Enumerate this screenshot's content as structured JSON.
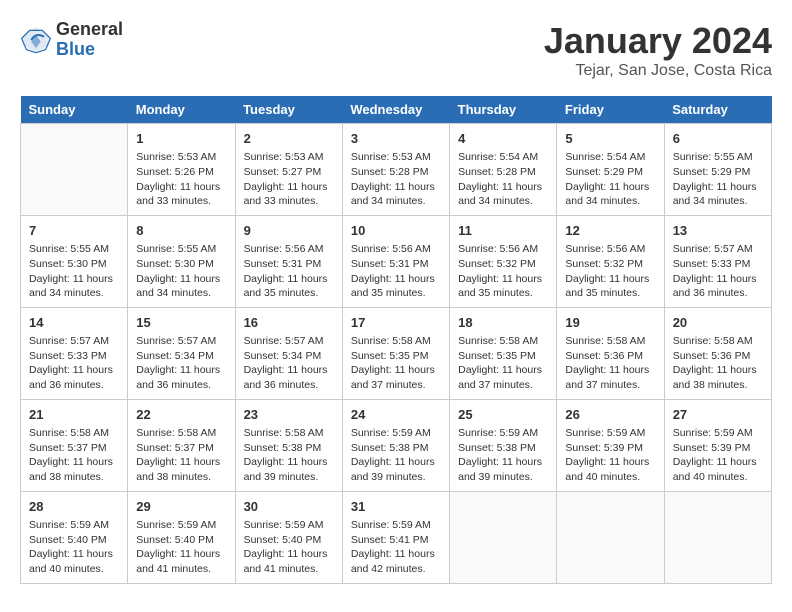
{
  "header": {
    "logo_line1": "General",
    "logo_line2": "Blue",
    "title": "January 2024",
    "subtitle": "Tejar, San Jose, Costa Rica"
  },
  "weekdays": [
    "Sunday",
    "Monday",
    "Tuesday",
    "Wednesday",
    "Thursday",
    "Friday",
    "Saturday"
  ],
  "weeks": [
    [
      {
        "day": "",
        "empty": true
      },
      {
        "day": "1",
        "sunrise": "5:53 AM",
        "sunset": "5:26 PM",
        "daylight": "11 hours and 33 minutes."
      },
      {
        "day": "2",
        "sunrise": "5:53 AM",
        "sunset": "5:27 PM",
        "daylight": "11 hours and 33 minutes."
      },
      {
        "day": "3",
        "sunrise": "5:53 AM",
        "sunset": "5:28 PM",
        "daylight": "11 hours and 34 minutes."
      },
      {
        "day": "4",
        "sunrise": "5:54 AM",
        "sunset": "5:28 PM",
        "daylight": "11 hours and 34 minutes."
      },
      {
        "day": "5",
        "sunrise": "5:54 AM",
        "sunset": "5:29 PM",
        "daylight": "11 hours and 34 minutes."
      },
      {
        "day": "6",
        "sunrise": "5:55 AM",
        "sunset": "5:29 PM",
        "daylight": "11 hours and 34 minutes."
      }
    ],
    [
      {
        "day": "7",
        "sunrise": "5:55 AM",
        "sunset": "5:30 PM",
        "daylight": "11 hours and 34 minutes."
      },
      {
        "day": "8",
        "sunrise": "5:55 AM",
        "sunset": "5:30 PM",
        "daylight": "11 hours and 34 minutes."
      },
      {
        "day": "9",
        "sunrise": "5:56 AM",
        "sunset": "5:31 PM",
        "daylight": "11 hours and 35 minutes."
      },
      {
        "day": "10",
        "sunrise": "5:56 AM",
        "sunset": "5:31 PM",
        "daylight": "11 hours and 35 minutes."
      },
      {
        "day": "11",
        "sunrise": "5:56 AM",
        "sunset": "5:32 PM",
        "daylight": "11 hours and 35 minutes."
      },
      {
        "day": "12",
        "sunrise": "5:56 AM",
        "sunset": "5:32 PM",
        "daylight": "11 hours and 35 minutes."
      },
      {
        "day": "13",
        "sunrise": "5:57 AM",
        "sunset": "5:33 PM",
        "daylight": "11 hours and 36 minutes."
      }
    ],
    [
      {
        "day": "14",
        "sunrise": "5:57 AM",
        "sunset": "5:33 PM",
        "daylight": "11 hours and 36 minutes."
      },
      {
        "day": "15",
        "sunrise": "5:57 AM",
        "sunset": "5:34 PM",
        "daylight": "11 hours and 36 minutes."
      },
      {
        "day": "16",
        "sunrise": "5:57 AM",
        "sunset": "5:34 PM",
        "daylight": "11 hours and 36 minutes."
      },
      {
        "day": "17",
        "sunrise": "5:58 AM",
        "sunset": "5:35 PM",
        "daylight": "11 hours and 37 minutes."
      },
      {
        "day": "18",
        "sunrise": "5:58 AM",
        "sunset": "5:35 PM",
        "daylight": "11 hours and 37 minutes."
      },
      {
        "day": "19",
        "sunrise": "5:58 AM",
        "sunset": "5:36 PM",
        "daylight": "11 hours and 37 minutes."
      },
      {
        "day": "20",
        "sunrise": "5:58 AM",
        "sunset": "5:36 PM",
        "daylight": "11 hours and 38 minutes."
      }
    ],
    [
      {
        "day": "21",
        "sunrise": "5:58 AM",
        "sunset": "5:37 PM",
        "daylight": "11 hours and 38 minutes."
      },
      {
        "day": "22",
        "sunrise": "5:58 AM",
        "sunset": "5:37 PM",
        "daylight": "11 hours and 38 minutes."
      },
      {
        "day": "23",
        "sunrise": "5:58 AM",
        "sunset": "5:38 PM",
        "daylight": "11 hours and 39 minutes."
      },
      {
        "day": "24",
        "sunrise": "5:59 AM",
        "sunset": "5:38 PM",
        "daylight": "11 hours and 39 minutes."
      },
      {
        "day": "25",
        "sunrise": "5:59 AM",
        "sunset": "5:38 PM",
        "daylight": "11 hours and 39 minutes."
      },
      {
        "day": "26",
        "sunrise": "5:59 AM",
        "sunset": "5:39 PM",
        "daylight": "11 hours and 40 minutes."
      },
      {
        "day": "27",
        "sunrise": "5:59 AM",
        "sunset": "5:39 PM",
        "daylight": "11 hours and 40 minutes."
      }
    ],
    [
      {
        "day": "28",
        "sunrise": "5:59 AM",
        "sunset": "5:40 PM",
        "daylight": "11 hours and 40 minutes."
      },
      {
        "day": "29",
        "sunrise": "5:59 AM",
        "sunset": "5:40 PM",
        "daylight": "11 hours and 41 minutes."
      },
      {
        "day": "30",
        "sunrise": "5:59 AM",
        "sunset": "5:40 PM",
        "daylight": "11 hours and 41 minutes."
      },
      {
        "day": "31",
        "sunrise": "5:59 AM",
        "sunset": "5:41 PM",
        "daylight": "11 hours and 42 minutes."
      },
      {
        "day": "",
        "empty": true
      },
      {
        "day": "",
        "empty": true
      },
      {
        "day": "",
        "empty": true
      }
    ]
  ]
}
